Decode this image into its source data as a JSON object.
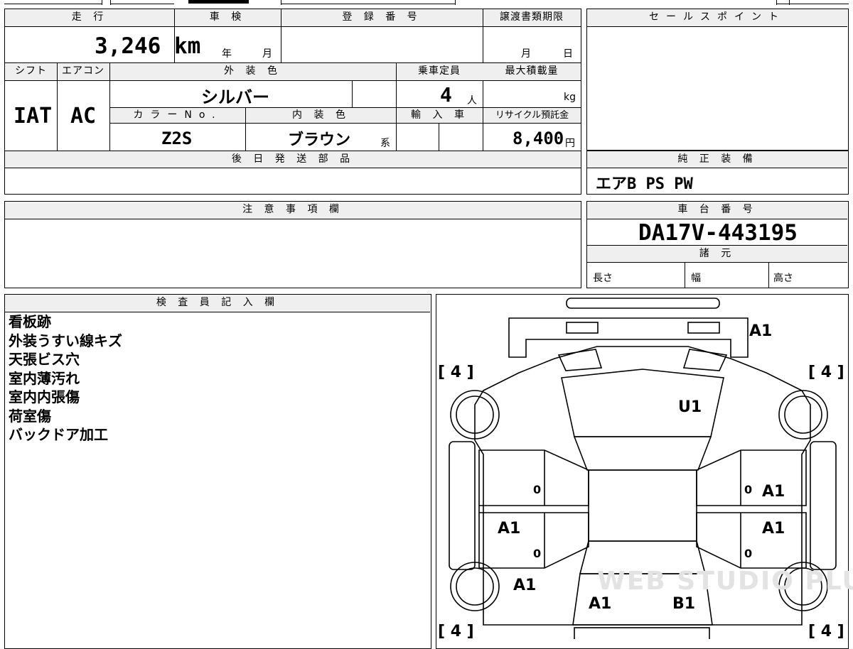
{
  "vehicle_info": {
    "mileage_header": "走 行",
    "mileage_value": "3,246 km",
    "shaken_header": "車 検",
    "shaken_year_unit": "年",
    "shaken_month_unit": "月",
    "registration_header": "登 録 番 号",
    "transfer_deadline_header": "譲渡書類期限",
    "transfer_month_unit": "月",
    "transfer_day_unit": "日",
    "shift_header": "シフト",
    "shift_value": "IAT",
    "ac_header": "エアコン",
    "ac_value": "AC",
    "exterior_color_header": "外 装 色",
    "exterior_color_value": "シルバー",
    "capacity_header": "乗車定員",
    "capacity_value": "4",
    "capacity_unit": "人",
    "max_load_header": "最大積載量",
    "max_load_unit": "kg",
    "color_no_header": "カラーNo.",
    "color_no_value": "Z2S",
    "interior_color_header": "内 装 色",
    "interior_color_value": "ブラウン",
    "interior_color_suffix": "系",
    "import_header": "輸 入 車",
    "recycle_header": "リサイクル預託金",
    "recycle_value": "8,400",
    "recycle_unit": "円",
    "later_parts_header": "後 日 発 送 部 品"
  },
  "sales_point": {
    "header": "セールスポイント"
  },
  "standard_equipment": {
    "header": "純 正 装 備",
    "value": "エアB PS PW"
  },
  "caution": {
    "header": "注 意 事 項 欄"
  },
  "chassis": {
    "header": "車 台 番 号",
    "value": "DA17V-443195"
  },
  "specs": {
    "header": "諸 元",
    "length_label": "長さ",
    "width_label": "幅",
    "height_label": "高さ"
  },
  "inspector": {
    "header": "検 査 員 記 入 欄",
    "notes": [
      "看板跡",
      "外装うすい線キズ",
      "天張ビス穴",
      "室内薄汚れ",
      "室内内張傷",
      "荷室傷",
      "バックドア加工"
    ]
  },
  "diagram": {
    "tire_markers": [
      "[ 4 ]",
      "[ 4 ]",
      "[ 4 ]",
      "[ 4 ]"
    ],
    "codes": {
      "front_bumper": "A1",
      "hood": "U1",
      "rear_right_door": "A1",
      "front_left_door": "A1",
      "front_right_door": "A1",
      "left_rear_quarter": "A1",
      "rear_left": "A1",
      "rear_right": "B1"
    },
    "door_zeros": [
      "0",
      "0",
      "0",
      "0"
    ]
  },
  "watermark": "WEB STUDIO PLUS"
}
